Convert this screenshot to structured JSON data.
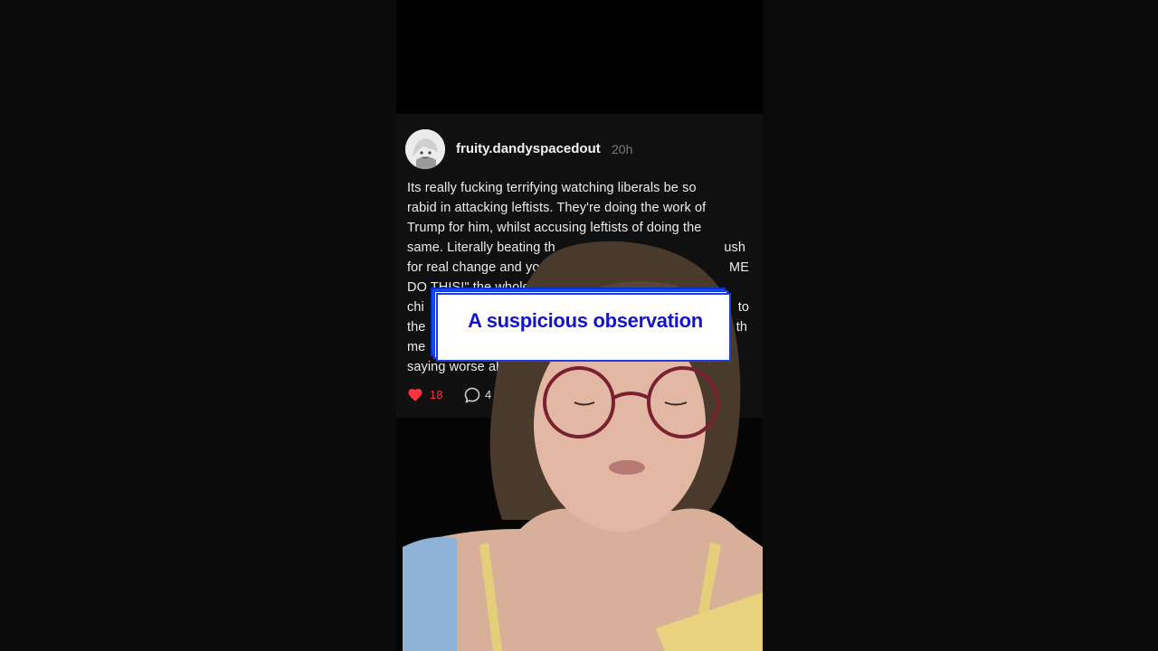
{
  "post": {
    "username": "fruity.dandyspacedout",
    "time": "20h",
    "lines": [
      "Its really fucking terrifying watching liberals be so",
      "rabid in attacking leftists. They're doing the work of",
      "Trump for him, whilst accusing leftists of doing the",
      "same. Literally beating th",
      "ush",
      "for real change and yo",
      "ME",
      "DO THIS!\" the whole",
      "chi",
      "to",
      "the",
      "th",
      "me",
      "saying worse ab"
    ],
    "like_count": "18",
    "comment_count": "4"
  },
  "overlay": {
    "caption": "A suspicious observation"
  },
  "icons": {
    "like": "heart-icon",
    "comment": "comment-icon"
  },
  "colors": {
    "like": "#ff3040",
    "caption_text": "#1414c8",
    "caption_border": "#1a3fe0"
  }
}
